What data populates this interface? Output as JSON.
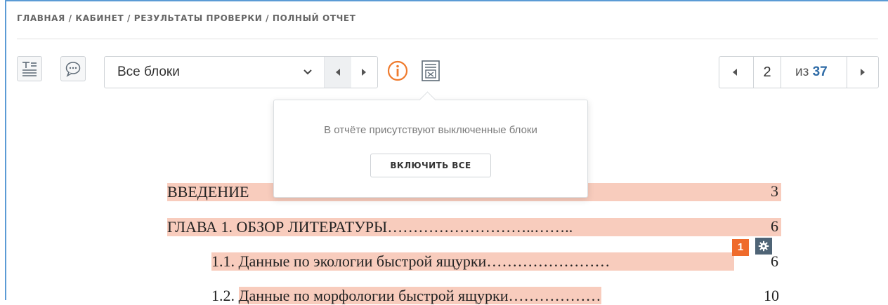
{
  "breadcrumb": {
    "text": "ГЛАВНАЯ / КАБИНЕТ / РЕЗУЛЬТАТЫ ПРОВЕРКИ / ПОЛНЫЙ ОТЧЕТ"
  },
  "toolbar": {
    "block_filter": {
      "selected": "Все блоки"
    }
  },
  "pager": {
    "current_page": "2",
    "of_label": "из",
    "total_pages": "37"
  },
  "popover": {
    "message": "В отчёте присутствуют выключенные блоки",
    "enable_all_label": "ВКЛЮЧИТЬ ВСЕ"
  },
  "document": {
    "lines": [
      {
        "text": "ВВЕДЕНИЕ",
        "page": "3"
      },
      {
        "text": "ГЛАВА 1. ОБЗОР ЛИТЕРАТУРЫ………………………..……..",
        "page": "6"
      },
      {
        "text": "1.1. Данные по экологии быстрой ящурки……………………",
        "page": "6"
      },
      {
        "text_prefix": "1.2. ",
        "text": "Данные по морфологии быстрой ящурки………………",
        "page": "10"
      }
    ]
  },
  "match_badge": {
    "count": "1"
  },
  "colors": {
    "highlight": "#f8ccbd",
    "badge_orange": "#ef6b2c",
    "badge_gear": "#4f6476",
    "info_orange": "#ef7b2e",
    "page_total_blue": "#2d6aa6",
    "frame_blue": "#5b9bd5"
  },
  "icons": {
    "text_view": "text-view-icon",
    "comments": "comments-icon",
    "chevron": "chevron-down-icon",
    "prev": "caret-left-icon",
    "next": "caret-right-icon",
    "info": "info-icon",
    "disabled_block": "document-x-icon",
    "gear": "gear-icon"
  }
}
